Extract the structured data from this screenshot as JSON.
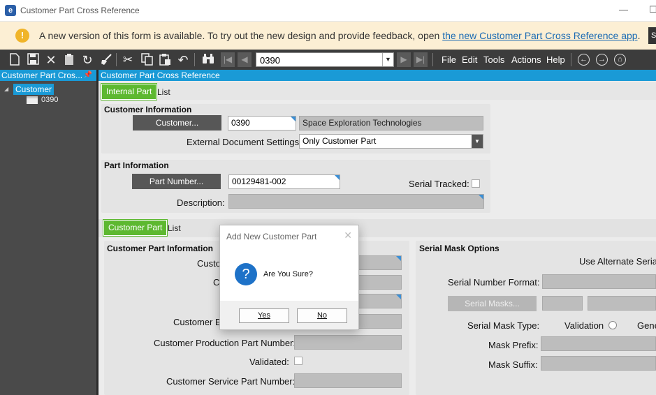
{
  "window": {
    "title": "Customer Part Cross Reference",
    "app_icon": "e-logo-icon",
    "maximize_glyph": "☐"
  },
  "banner": {
    "icon": "warning-icon",
    "text": "A new version of this form is available. To try out the new design and provide feedback, open ",
    "link_text": "the new Customer Part Cross Reference app",
    "trailing": ".",
    "button_label": "S"
  },
  "toolbar": {
    "icons": [
      "new-icon",
      "save-icon",
      "delete-icon",
      "clipboard-icon",
      "refresh-icon",
      "clear-icon",
      "cut-icon",
      "copy-icon",
      "paste-icon",
      "undo-icon",
      "search-binoculars-icon"
    ],
    "record_combo_value": "0390",
    "menu": [
      "File",
      "Edit",
      "Tools",
      "Actions",
      "Help"
    ],
    "nav_icons": [
      "back-circle-icon",
      "forward-circle-icon",
      "home-circle-icon"
    ]
  },
  "tree_panel": {
    "header": "Customer Part Cros...",
    "root_label": "Customer",
    "child_label": "0390"
  },
  "main": {
    "header": "Customer Part Cross Reference",
    "top_tabs": [
      "Internal Part",
      "List"
    ],
    "customer_info": {
      "title": "Customer Information",
      "customer_button": "Customer...",
      "customer_id": "0390",
      "customer_name": "Space Exploration Technologies",
      "ext_doc_label": "External Document Settings:",
      "ext_doc_value": "Only Customer Part"
    },
    "part_info": {
      "title": "Part Information",
      "part_button": "Part Number...",
      "part_number": "00129481-002",
      "serial_tracked_label": "Serial Tracked:",
      "serial_tracked": false,
      "description_label": "Description:",
      "description": ""
    },
    "bottom_tabs": [
      "Customer Part",
      "List"
    ],
    "customer_part_info": {
      "title": "Customer Part Information",
      "fields": [
        {
          "label": "Custo",
          "value": ""
        },
        {
          "label": "C",
          "value": ""
        },
        {
          "label": "",
          "value": ""
        },
        {
          "label": "Customer E",
          "value": ""
        },
        {
          "label": "Customer Production Part Number:",
          "value": ""
        },
        {
          "label": "Validated:",
          "value": ""
        },
        {
          "label": "Customer Service Part Number:",
          "value": ""
        }
      ]
    },
    "serial_mask": {
      "title": "Serial Mask Options",
      "use_alternate_label": "Use Alternate Serial",
      "format_label": "Serial Number Format:",
      "masks_button": "Serial Masks...",
      "mask_type_label": "Serial Mask Type:",
      "radio_validation": "Validation",
      "radio_generate": "Gene",
      "prefix_label": "Mask Prefix:",
      "suffix_label": "Mask Suffix:"
    }
  },
  "dialog": {
    "title": "Add New Customer Part",
    "icon": "question-icon",
    "message": "Are You Sure?",
    "yes_label": "Yes",
    "no_label": "No"
  }
}
